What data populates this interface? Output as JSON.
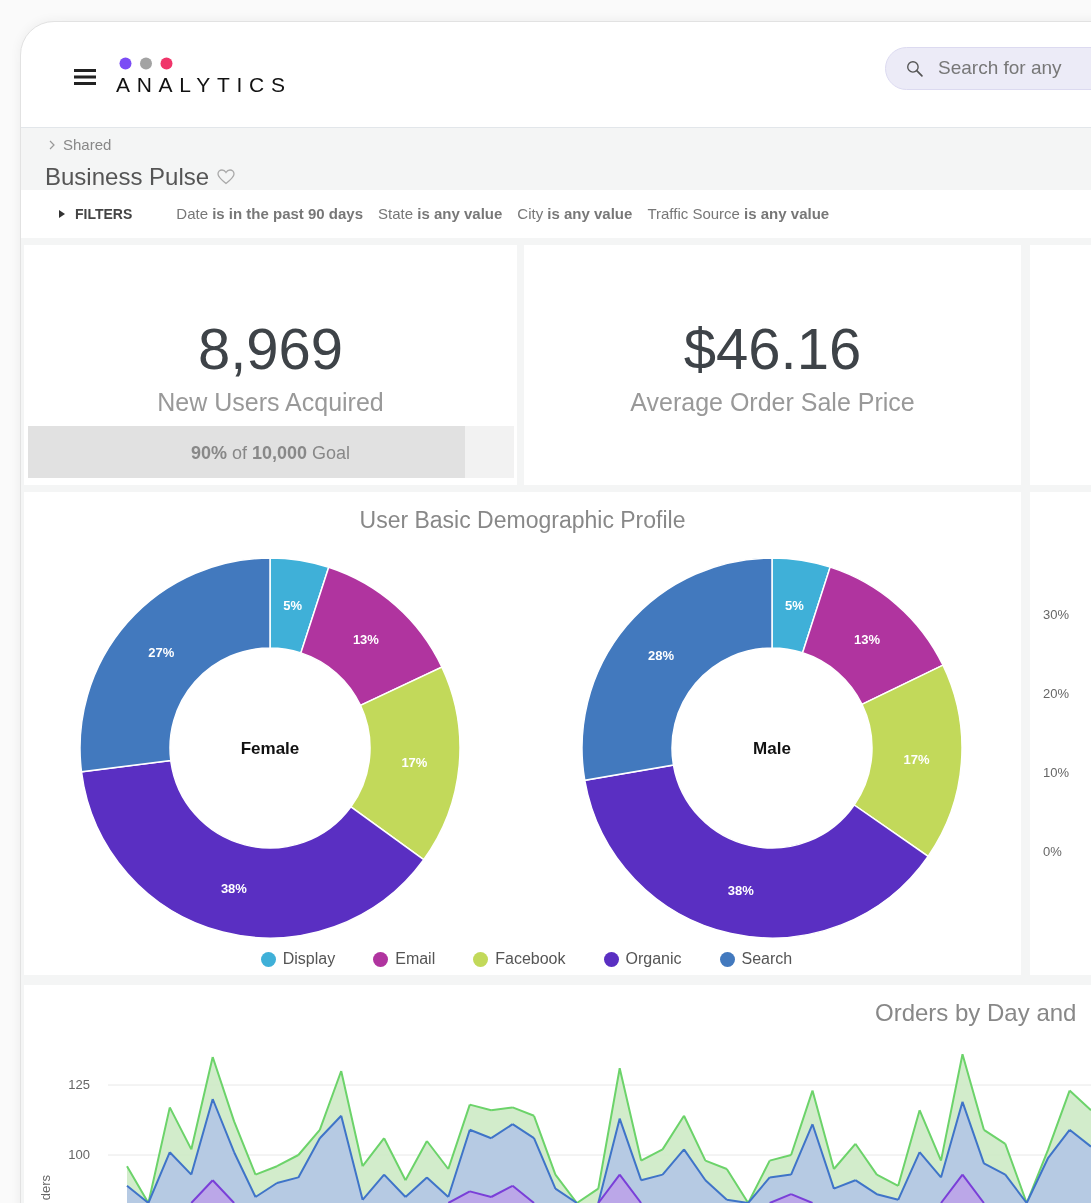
{
  "header": {
    "logo_text": "ANALYTICS",
    "search": {
      "placeholder": "Search for any"
    }
  },
  "breadcrumb": {
    "parent": "Shared",
    "title": "Business Pulse",
    "favorite": false
  },
  "filters": {
    "label": "FILTERS",
    "expanded": false,
    "items": [
      "Date **is in the past 90 days**",
      "State **is any value**",
      "City **is any value**",
      "Traffic Source **is any value**"
    ]
  },
  "kpis": [
    {
      "value": "8,969",
      "label": "New Users Acquired",
      "goal": {
        "text": "**90%** of **10,000** Goal",
        "level": 0.9
      }
    },
    {
      "value": "$46.16",
      "label": "Average Order Sale Price"
    }
  ],
  "demographics": {
    "title": "User Basic Demographic Profile",
    "donuts": [
      {
        "chart_data": {
          "type": "donut",
          "title": "Female",
          "values": [
            5,
            13,
            17,
            38,
            27
          ],
          "value_labels": [
            "5%",
            "13%",
            "17%",
            "38%",
            "27%"
          ]
        }
      },
      {
        "chart_data": {
          "type": "donut",
          "title": "Male",
          "values": [
            5,
            13,
            17,
            38,
            28
          ],
          "value_labels": [
            "5%",
            "13%",
            "17%",
            "38%",
            "28%"
          ]
        }
      }
    ],
    "legend": [
      {
        "label": "Display",
        "color": "#3fb0d8"
      },
      {
        "label": "Email",
        "color": "#b0349f"
      },
      {
        "label": "Facebook",
        "color": "#c2d95a"
      },
      {
        "label": "Organic",
        "color": "#5a2fc2"
      },
      {
        "label": "Search",
        "color": "#4279be"
      }
    ]
  },
  "side_chart": {
    "axis_labels": [
      "30%",
      "20%",
      "10%",
      "0%"
    ]
  },
  "orders_chart": {
    "title": "Orders by Day and",
    "tick_labels": [
      "125",
      "100"
    ],
    "axis_title": "ders"
  }
}
